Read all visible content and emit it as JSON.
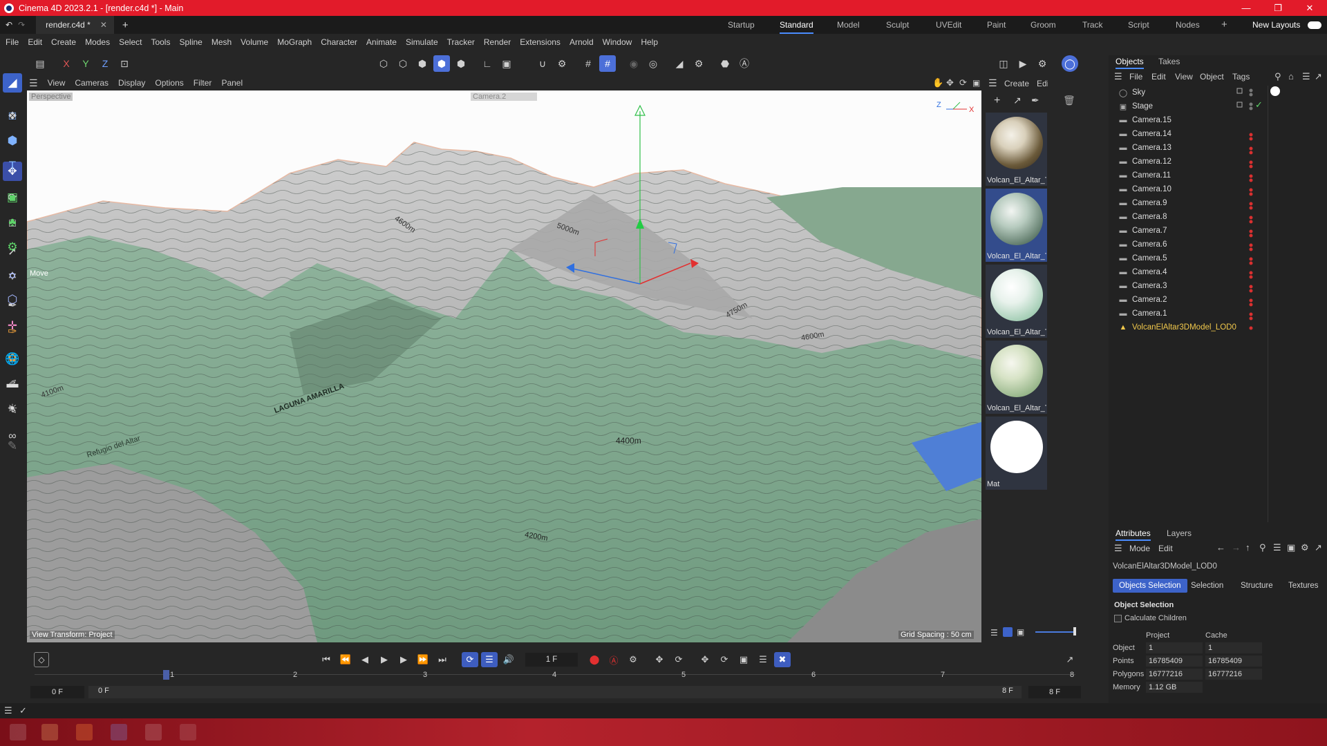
{
  "title": "Cinema 4D 2023.2.1 - [render.c4d *] - Main",
  "document_tab": "render.c4d *",
  "layout_tabs": [
    "Startup",
    "Standard",
    "Model",
    "Sculpt",
    "UVEdit",
    "Paint",
    "Groom",
    "Track",
    "Script",
    "Nodes"
  ],
  "active_layout": "Standard",
  "new_layouts_label": "New Layouts",
  "menu": [
    "File",
    "Edit",
    "Create",
    "Modes",
    "Select",
    "Tools",
    "Spline",
    "Mesh",
    "Volume",
    "MoGraph",
    "Character",
    "Animate",
    "Simulate",
    "Tracker",
    "Render",
    "Extensions",
    "Arnold",
    "Window",
    "Help"
  ],
  "axis_buttons": [
    "X",
    "Y",
    "Z"
  ],
  "viewport": {
    "menu": [
      "View",
      "Cameras",
      "Display",
      "Options",
      "Filter",
      "Panel"
    ],
    "name": "Perspective",
    "camera": "Camera.2",
    "tool_label": "Move",
    "view_transform": "View Transform: Project",
    "grid_spacing": "Grid Spacing : 50 cm",
    "contours": [
      "4600m",
      "5000m",
      "4750m",
      "4600m",
      "4400m",
      "4200m",
      "4100m"
    ],
    "map_labels": [
      "LAGUNA AMARILLA",
      "Refugio del Altar"
    ]
  },
  "materials": {
    "menu": [
      "Create",
      "Edit"
    ],
    "items": [
      {
        "label": "Volcan_El_Altar_Te",
        "color": "#6b5a3a"
      },
      {
        "label": "Volcan_El_Altar_Te",
        "color": "#7ea08e"
      },
      {
        "label": "Volcan_El_Altar_Te",
        "color": "#cfe4d6"
      },
      {
        "label": "Volcan_El_Altar_Te",
        "color": "#a8c29b"
      },
      {
        "label": "Mat",
        "color": "#ffffff"
      }
    ]
  },
  "objects": {
    "tabs": [
      "Objects",
      "Takes"
    ],
    "menu": [
      "File",
      "Edit",
      "View",
      "Object",
      "Tags"
    ],
    "items": [
      "Sky",
      "Stage",
      "Camera.15",
      "Camera.14",
      "Camera.13",
      "Camera.12",
      "Camera.11",
      "Camera.10",
      "Camera.9",
      "Camera.8",
      "Camera.7",
      "Camera.6",
      "Camera.5",
      "Camera.4",
      "Camera.3",
      "Camera.2",
      "Camera.1",
      "VolcanElAltar3DModel_LOD0"
    ]
  },
  "attributes": {
    "tabs": [
      "Attributes",
      "Layers"
    ],
    "menu": [
      "Mode",
      "Edit"
    ],
    "object_name": "VolcanElAltar3DModel_LOD0",
    "sub_tabs": [
      "Objects Selection",
      "Selection",
      "Structure",
      "Textures"
    ],
    "section": "Object Selection",
    "calc_children": "Calculate Children",
    "col_project": "Project",
    "col_cache": "Cache",
    "rows": [
      {
        "label": "Object",
        "project": "1",
        "cache": "1"
      },
      {
        "label": "Points",
        "project": "16785409",
        "cache": "16785409"
      },
      {
        "label": "Polygons",
        "project": "16777216",
        "cache": "16777216"
      },
      {
        "label": "Memory",
        "project": "1.12 GB",
        "cache": ""
      }
    ]
  },
  "timeline": {
    "frame": "1 F",
    "ticks": [
      "1",
      "2",
      "3",
      "4",
      "5",
      "6",
      "7",
      "8"
    ],
    "start": "0 F",
    "start2": "0 F",
    "end": "8 F",
    "end2": "8 F"
  },
  "colors": {
    "titlebar": "#e21b2a",
    "accent": "#4c6fd8",
    "highlight": "#f2c94c"
  }
}
